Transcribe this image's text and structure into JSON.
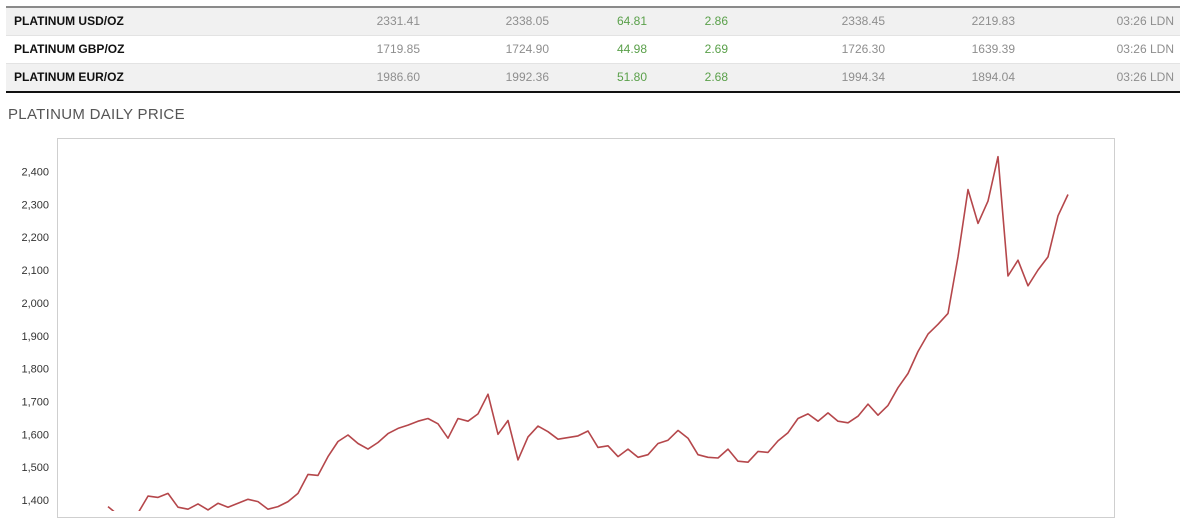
{
  "table": {
    "rows": [
      {
        "name": "PLATINUM USD/OZ",
        "bid": "2331.41",
        "ask": "2338.05",
        "change": "64.81",
        "change_pct": "2.86",
        "high": "2338.45",
        "low": "2219.83",
        "time": "03:26 LDN"
      },
      {
        "name": "PLATINUM GBP/OZ",
        "bid": "1719.85",
        "ask": "1724.90",
        "change": "44.98",
        "change_pct": "2.69",
        "high": "1726.30",
        "low": "1639.39",
        "time": "03:26 LDN"
      },
      {
        "name": "PLATINUM EUR/OZ",
        "bid": "1986.60",
        "ask": "1992.36",
        "change": "51.80",
        "change_pct": "2.68",
        "high": "1994.34",
        "low": "1894.04",
        "time": "03:26 LDN"
      }
    ]
  },
  "colors": {
    "line": "#b5474b",
    "positive": "#5aa04a"
  },
  "chart_title": "PLATINUM DAILY PRICE",
  "chart_data": {
    "type": "line",
    "title": "PLATINUM DAILY PRICE",
    "xlabel": "",
    "ylabel": "",
    "ylim": [
      1360,
      2500
    ],
    "y_ticks": [
      "1,400",
      "1,500",
      "1,600",
      "1,700",
      "1,800",
      "1,900",
      "2,000",
      "2,100",
      "2,200",
      "2,300",
      "2,400"
    ],
    "grid": false,
    "series": [
      {
        "values": [
          1380,
          1355,
          1350,
          1360,
          1412,
          1408,
          1420,
          1378,
          1372,
          1388,
          1370,
          1390,
          1378,
          1390,
          1402,
          1395,
          1372,
          1380,
          1395,
          1420,
          1478,
          1475,
          1532,
          1578,
          1598,
          1572,
          1555,
          1575,
          1602,
          1618,
          1628,
          1640,
          1648,
          1632,
          1588,
          1648,
          1640,
          1662,
          1722,
          1600,
          1642,
          1522,
          1592,
          1625,
          1608,
          1585,
          1590,
          1595,
          1610,
          1560,
          1565,
          1532,
          1555,
          1530,
          1538,
          1572,
          1582,
          1612,
          1588,
          1538,
          1530,
          1528,
          1555,
          1518,
          1515,
          1548,
          1545,
          1580,
          1605,
          1648,
          1662,
          1640,
          1665,
          1640,
          1635,
          1655,
          1692,
          1658,
          1688,
          1742,
          1785,
          1852,
          1905,
          1935,
          1968,
          2140,
          2345,
          2242,
          2310,
          2445,
          2082,
          2130,
          2052,
          2100,
          2140,
          2265,
          2330
        ]
      }
    ]
  }
}
